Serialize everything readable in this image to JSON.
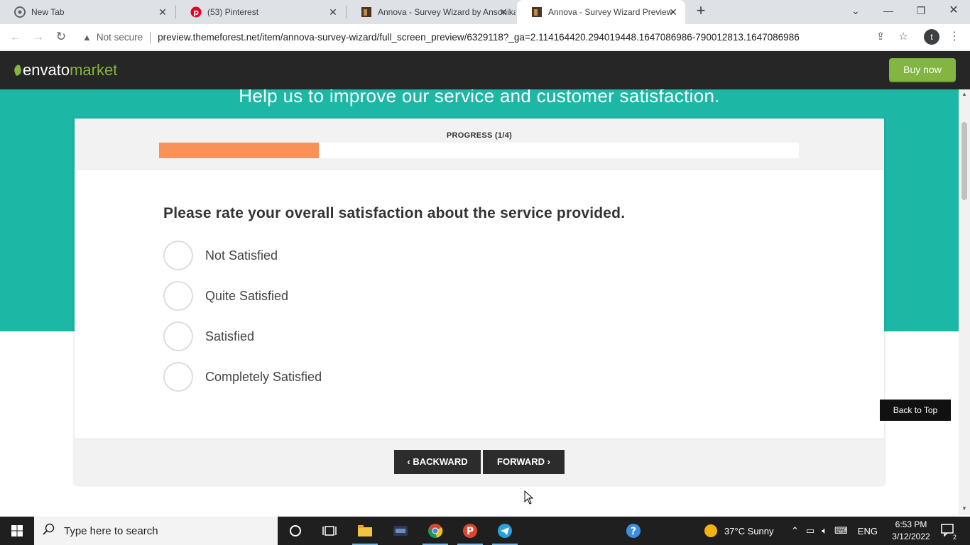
{
  "browser": {
    "tabs": [
      {
        "title": "New Tab",
        "icon": "chrome-icon"
      },
      {
        "title": "(53) Pinterest",
        "icon": "pinterest-icon"
      },
      {
        "title": "Annova - Survey Wizard by Ansonika",
        "icon": "themeforest-icon"
      },
      {
        "title": "Annova - Survey Wizard Preview",
        "icon": "themeforest-icon"
      }
    ],
    "security_label": "Not secure",
    "url": "preview.themeforest.net/item/annova-survey-wizard/full_screen_preview/6329118?_ga=2.114164420.294019448.1647086986-790012813.1647086986",
    "profile_initial": "t"
  },
  "envato": {
    "logo_text": "envato",
    "logo_market": "market",
    "buy_now": "Buy now",
    "brand_color": "#82b541"
  },
  "survey": {
    "subtitle": "Help us to improve our service and customer satisfaction.",
    "progress_label": "PROGRESS (1/4)",
    "progress_fraction": 0.25,
    "question": "Please rate your overall satisfaction about the service provided.",
    "options": [
      "Not Satisfied",
      "Quite Satisfied",
      "Satisfied",
      "Completely Satisfied"
    ],
    "backward_label": "BACKWARD",
    "forward_label": "FORWARD",
    "back_to_top": "Back to Top",
    "accent_color": "#1cb7a5",
    "progress_color": "#f89258"
  },
  "taskbar": {
    "search_placeholder": "Type here to search",
    "weather": "37°C  Sunny",
    "language": "ENG",
    "time": "6:53 PM",
    "date": "3/12/2022",
    "notification_count": "2"
  }
}
